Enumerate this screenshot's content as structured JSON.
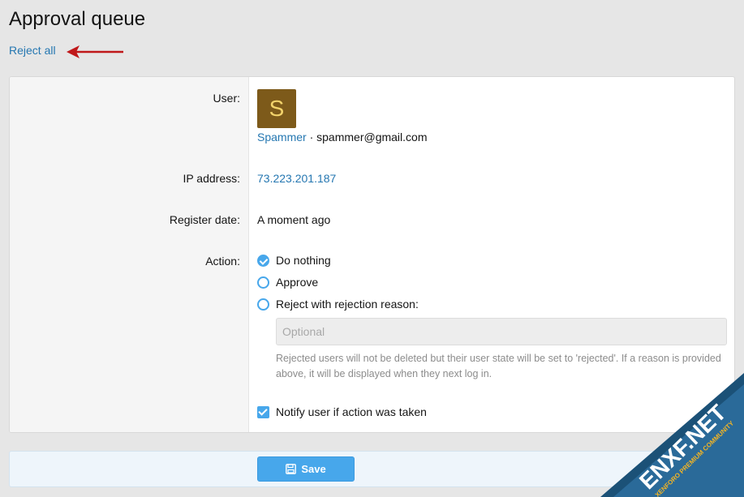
{
  "page": {
    "title": "Approval queue",
    "reject_all_label": "Reject all"
  },
  "form": {
    "user": {
      "label": "User:",
      "avatar_letter": "S",
      "avatar_color": "#7d5a1a",
      "username": "Spammer",
      "separator": "·",
      "email": "spammer@gmail.com"
    },
    "ip": {
      "label": "IP address:",
      "value": "73.223.201.187"
    },
    "register_date": {
      "label": "Register date:",
      "value": "A moment ago"
    },
    "action": {
      "label": "Action:",
      "options": [
        {
          "label": "Do nothing",
          "checked": true
        },
        {
          "label": "Approve",
          "checked": false
        },
        {
          "label": "Reject with rejection reason:",
          "checked": false
        }
      ],
      "reason_placeholder": "Optional",
      "reason_value": "",
      "hint": "Rejected users will not be deleted but their user state will be set to 'rejected'. If a reason is provided above, it will be displayed when they next log in."
    },
    "notify": {
      "label": "Notify user if action was taken",
      "checked": true
    }
  },
  "footer": {
    "save_label": "Save",
    "save_icon": "save-icon"
  },
  "watermark": {
    "brand": "ENXF.NET",
    "tagline": "XENFORO PREMIUM COMMUNITY"
  },
  "colors": {
    "accent": "#47a7eb",
    "link": "#2577b1",
    "arrow": "#c0181a"
  }
}
